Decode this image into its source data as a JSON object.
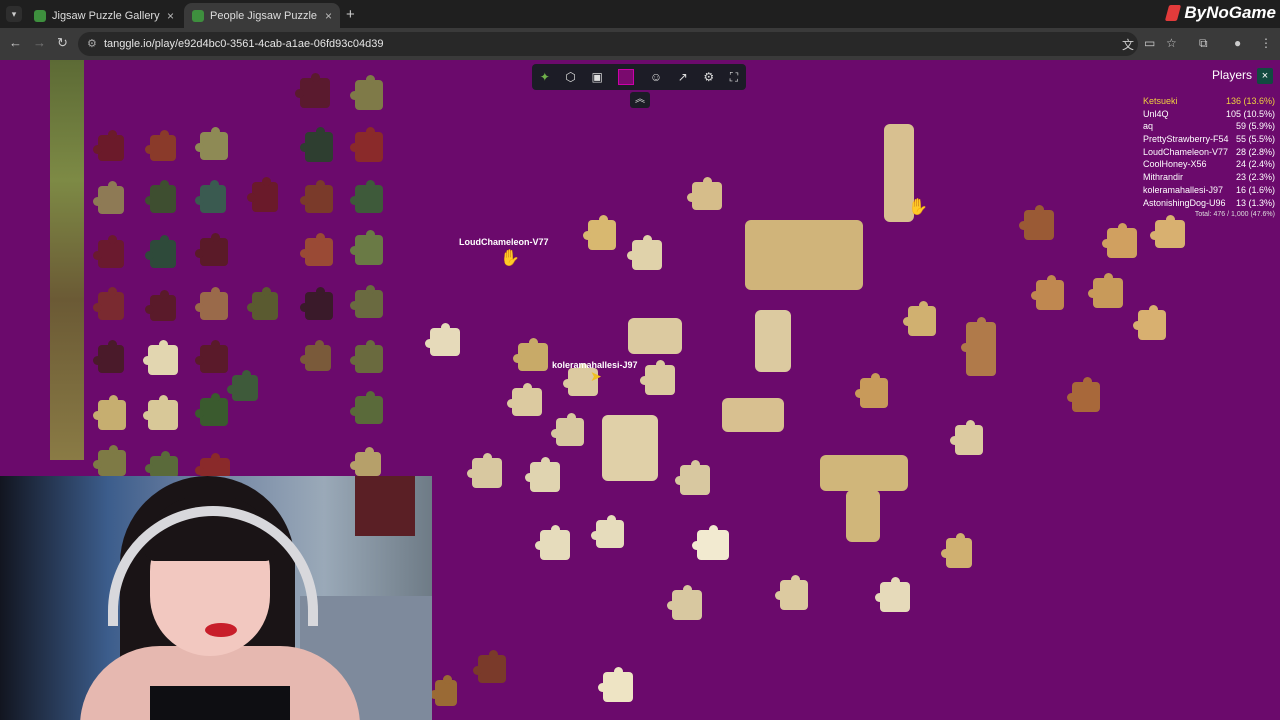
{
  "browser": {
    "tabs": [
      {
        "title": "Jigsaw Puzzle Gallery",
        "active": false
      },
      {
        "title": "People Jigsaw Puzzle",
        "active": true
      }
    ],
    "url": "tanggle.io/play/e92d4bc0-3561-4cab-a1ae-06fd93c04d39",
    "brand": "ByNoGame"
  },
  "game": {
    "background_color": "#6b0a6c",
    "players_title": "Players",
    "players": [
      {
        "name": "Ketsueki",
        "score": "136 (13.6%)"
      },
      {
        "name": "Unl4Q",
        "score": "105 (10.5%)"
      },
      {
        "name": "aq",
        "score": "59 (5.9%)"
      },
      {
        "name": "PrettyStrawberry-F54",
        "score": "55 (5.5%)"
      },
      {
        "name": "LoudChameleon-V77",
        "score": "28 (2.8%)"
      },
      {
        "name": "CoolHoney-X56",
        "score": "24 (2.4%)"
      },
      {
        "name": "Mithrandir",
        "score": "23 (2.3%)"
      },
      {
        "name": "koleramahallesi-J97",
        "score": "16 (1.6%)"
      },
      {
        "name": "AstonishingDog-U96",
        "score": "13 (1.3%)"
      }
    ],
    "total": "Total: 476 / 1,000 (47.6%)",
    "cursors": [
      {
        "label": "LoudChameleon-V77"
      },
      {
        "label": "koleramahallesi-J97"
      }
    ]
  }
}
